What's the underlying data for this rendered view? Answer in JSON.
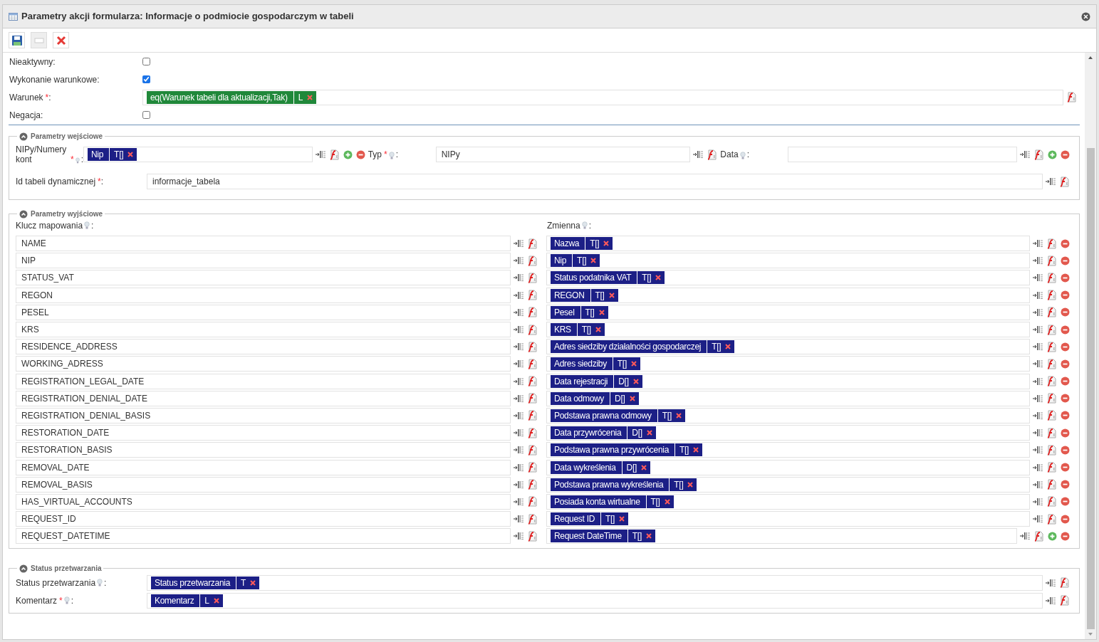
{
  "window": {
    "title": "Parametry akcji formularza: Informacje o podmiocie gospodarczym w tabeli"
  },
  "toolbar": [
    {
      "kind": "save",
      "disabled": false
    },
    {
      "kind": "blank",
      "disabled": true
    },
    {
      "kind": "delete",
      "disabled": false
    }
  ],
  "general": [
    {
      "kind": "checkbox",
      "label": "Nieaktywny:",
      "checked": false
    },
    {
      "kind": "checkbox",
      "label": "Wykonanie warunkowe:",
      "checked": true
    },
    {
      "kind": "tags",
      "label": "Warunek",
      "required_mark": "*",
      "suffix": ":",
      "hint": false,
      "tags": [
        {
          "kind": "expression",
          "text": "eq(Warunek tabeli dla aktualizacji,Tak)",
          "type": "L"
        }
      ],
      "actions": [
        {
          "kind": "formula"
        }
      ]
    },
    {
      "kind": "checkbox",
      "label": "Negacja:",
      "checked": false
    }
  ],
  "input_section": {
    "title": "Parametry wejściowe",
    "expanded": true,
    "rows": [
      {
        "params": [
          {
            "label": "NIPy/Numery kont",
            "required_mark": "*",
            "suffix": ":",
            "hint": true,
            "tags": [
              {
                "kind": "variable",
                "text": "Nip",
                "type": "T[]"
              }
            ],
            "actions": [
              {
                "kind": "map"
              },
              {
                "kind": "formula"
              },
              {
                "kind": "add"
              },
              {
                "kind": "remove"
              }
            ]
          },
          {
            "label": "Typ",
            "required_mark": "*",
            "suffix": ":",
            "hint": true,
            "value": "NIPy",
            "actions": [
              {
                "kind": "map"
              },
              {
                "kind": "formula"
              }
            ]
          },
          {
            "label": "Data",
            "suffix": ":",
            "hint": true,
            "actions": [
              {
                "kind": "map"
              },
              {
                "kind": "formula"
              },
              {
                "kind": "add"
              },
              {
                "kind": "remove"
              }
            ]
          }
        ]
      },
      {
        "params": [
          {
            "label": "Id tabeli dynamicznej",
            "required_mark": "*",
            "suffix": ":",
            "hint": false,
            "value": "informacje_tabela",
            "actions": [
              {
                "kind": "map"
              },
              {
                "kind": "formula"
              }
            ]
          }
        ]
      }
    ]
  },
  "output_section": {
    "title": "Parametry wyjściowe",
    "expanded": true,
    "key_header": {
      "label": "Klucz mapowania",
      "hint": true,
      "suffix": ":"
    },
    "var_header": {
      "label": "Zmienna",
      "hint": true,
      "suffix": ":"
    },
    "rows": [
      {
        "key": "NAME",
        "tags": [
          {
            "kind": "variable",
            "text": "Nazwa",
            "type": "T[]"
          }
        ],
        "actions": [
          {
            "kind": "map"
          },
          {
            "kind": "formula"
          },
          {
            "kind": "remove"
          }
        ]
      },
      {
        "key": "NIP",
        "tags": [
          {
            "kind": "variable",
            "text": "Nip",
            "type": "T[]"
          }
        ],
        "actions": [
          {
            "kind": "map"
          },
          {
            "kind": "formula"
          },
          {
            "kind": "remove"
          }
        ]
      },
      {
        "key": "STATUS_VAT",
        "tags": [
          {
            "kind": "variable",
            "text": "Status podatnika VAT",
            "type": "T[]"
          }
        ],
        "actions": [
          {
            "kind": "map"
          },
          {
            "kind": "formula"
          },
          {
            "kind": "remove"
          }
        ]
      },
      {
        "key": "REGON",
        "tags": [
          {
            "kind": "variable",
            "text": "REGON",
            "type": "T[]"
          }
        ],
        "actions": [
          {
            "kind": "map"
          },
          {
            "kind": "formula"
          },
          {
            "kind": "remove"
          }
        ]
      },
      {
        "key": "PESEL",
        "tags": [
          {
            "kind": "variable",
            "text": "Pesel",
            "type": "T[]"
          }
        ],
        "actions": [
          {
            "kind": "map"
          },
          {
            "kind": "formula"
          },
          {
            "kind": "remove"
          }
        ]
      },
      {
        "key": "KRS",
        "tags": [
          {
            "kind": "variable",
            "text": "KRS",
            "type": "T[]"
          }
        ],
        "actions": [
          {
            "kind": "map"
          },
          {
            "kind": "formula"
          },
          {
            "kind": "remove"
          }
        ]
      },
      {
        "key": "RESIDENCE_ADDRESS",
        "tags": [
          {
            "kind": "variable",
            "text": "Adres siedziby działalności gospodarczej",
            "type": "T[]"
          }
        ],
        "actions": [
          {
            "kind": "map"
          },
          {
            "kind": "formula"
          },
          {
            "kind": "remove"
          }
        ]
      },
      {
        "key": "WORKING_ADRESS",
        "tags": [
          {
            "kind": "variable",
            "text": "Adres siedziby",
            "type": "T[]"
          }
        ],
        "actions": [
          {
            "kind": "map"
          },
          {
            "kind": "formula"
          },
          {
            "kind": "remove"
          }
        ]
      },
      {
        "key": "REGISTRATION_LEGAL_DATE",
        "tags": [
          {
            "kind": "variable",
            "text": "Data rejestracji",
            "type": "D[]"
          }
        ],
        "actions": [
          {
            "kind": "map"
          },
          {
            "kind": "formula"
          },
          {
            "kind": "remove"
          }
        ]
      },
      {
        "key": "REGISTRATION_DENIAL_DATE",
        "tags": [
          {
            "kind": "variable",
            "text": "Data odmowy",
            "type": "D[]"
          }
        ],
        "actions": [
          {
            "kind": "map"
          },
          {
            "kind": "formula"
          },
          {
            "kind": "remove"
          }
        ]
      },
      {
        "key": "REGISTRATION_DENIAL_BASIS",
        "tags": [
          {
            "kind": "variable",
            "text": "Podstawa prawna odmowy",
            "type": "T[]"
          }
        ],
        "actions": [
          {
            "kind": "map"
          },
          {
            "kind": "formula"
          },
          {
            "kind": "remove"
          }
        ]
      },
      {
        "key": "RESTORATION_DATE",
        "tags": [
          {
            "kind": "variable",
            "text": "Data przywrócenia",
            "type": "D[]"
          }
        ],
        "actions": [
          {
            "kind": "map"
          },
          {
            "kind": "formula"
          },
          {
            "kind": "remove"
          }
        ]
      },
      {
        "key": "RESTORATION_BASIS",
        "tags": [
          {
            "kind": "variable",
            "text": "Podstawa prawna przywrócenia",
            "type": "T[]"
          }
        ],
        "actions": [
          {
            "kind": "map"
          },
          {
            "kind": "formula"
          },
          {
            "kind": "remove"
          }
        ]
      },
      {
        "key": "REMOVAL_DATE",
        "tags": [
          {
            "kind": "variable",
            "text": "Data wykreślenia",
            "type": "D[]"
          }
        ],
        "actions": [
          {
            "kind": "map"
          },
          {
            "kind": "formula"
          },
          {
            "kind": "remove"
          }
        ]
      },
      {
        "key": "REMOVAL_BASIS",
        "tags": [
          {
            "kind": "variable",
            "text": "Podstawa prawna wykreślenia",
            "type": "T[]"
          }
        ],
        "actions": [
          {
            "kind": "map"
          },
          {
            "kind": "formula"
          },
          {
            "kind": "remove"
          }
        ]
      },
      {
        "key": "HAS_VIRTUAL_ACCOUNTS",
        "tags": [
          {
            "kind": "variable",
            "text": "Posiada konta wirtualne",
            "type": "T[]"
          }
        ],
        "actions": [
          {
            "kind": "map"
          },
          {
            "kind": "formula"
          },
          {
            "kind": "remove"
          }
        ]
      },
      {
        "key": "REQUEST_ID",
        "tags": [
          {
            "kind": "variable",
            "text": "Request ID",
            "type": "T[]"
          }
        ],
        "actions": [
          {
            "kind": "map"
          },
          {
            "kind": "formula"
          },
          {
            "kind": "remove"
          }
        ]
      },
      {
        "key": "REQUEST_DATETIME",
        "tags": [
          {
            "kind": "variable",
            "text": "Request DateTime",
            "type": "T[]"
          }
        ],
        "actions": [
          {
            "kind": "map"
          },
          {
            "kind": "formula"
          },
          {
            "kind": "add"
          },
          {
            "kind": "remove"
          }
        ]
      }
    ]
  },
  "status_section": {
    "title": "Status przetwarzania",
    "expanded": true,
    "rows": [
      {
        "label": "Status przetwarzania",
        "suffix": ":",
        "hint": true,
        "tags": [
          {
            "kind": "variable",
            "text": "Status przetwarzania",
            "type": "T"
          }
        ],
        "actions": [
          {
            "kind": "map"
          },
          {
            "kind": "formula"
          }
        ]
      },
      {
        "label": "Komentarz",
        "required_mark": "*",
        "suffix": ":",
        "hint": true,
        "tags": [
          {
            "kind": "variable",
            "text": "Komentarz",
            "type": "L"
          }
        ],
        "actions": [
          {
            "kind": "map"
          },
          {
            "kind": "formula"
          }
        ]
      }
    ]
  }
}
